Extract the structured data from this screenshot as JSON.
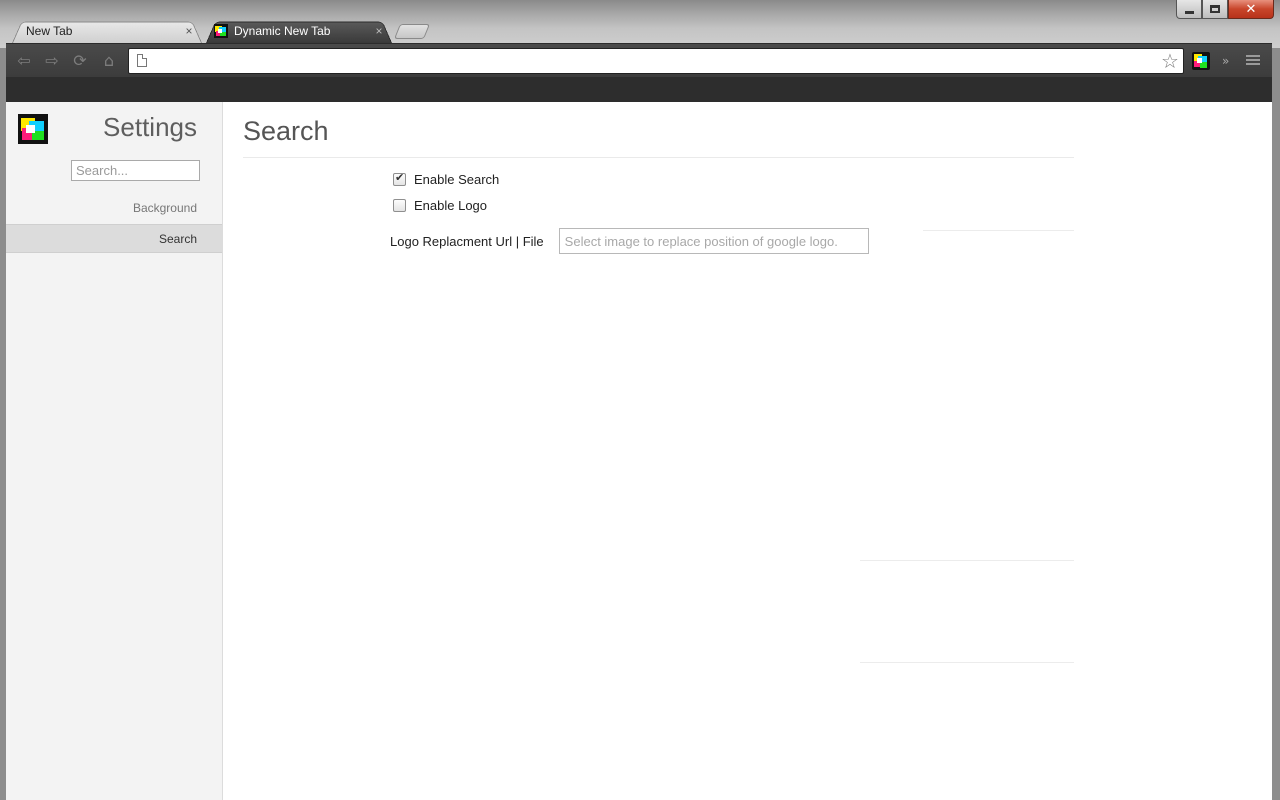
{
  "browser": {
    "tabs": [
      {
        "title": "New Tab",
        "close": "×",
        "active": false
      },
      {
        "title": "Dynamic New Tab",
        "close": "×",
        "active": true
      }
    ],
    "window_controls": {
      "close": "✕"
    },
    "toolbar": {
      "back": "⇦",
      "forward": "⇨",
      "reload": "⟳",
      "home": "⌂",
      "url": "",
      "star": "☆",
      "overflow": "»"
    }
  },
  "sidebar": {
    "title": "Settings",
    "search_placeholder": "Search...",
    "items": [
      {
        "label": "Background",
        "active": false
      },
      {
        "label": "Search",
        "active": true
      }
    ]
  },
  "main": {
    "title": "Search",
    "options": [
      {
        "label": "Enable Search",
        "checked": true
      },
      {
        "label": "Enable Logo",
        "checked": false
      }
    ],
    "logo_field": {
      "label": "Logo Replacment Url | File",
      "placeholder": "Select image to replace position of google logo."
    }
  },
  "icons": {
    "favicon_colors": [
      "#ffe800",
      "#10d0ff",
      "#ff1c7a",
      "#20e020"
    ]
  }
}
